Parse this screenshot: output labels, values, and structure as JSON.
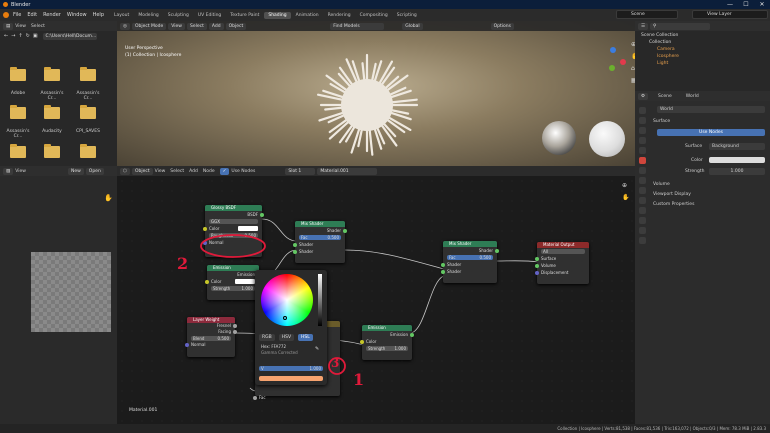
{
  "window": {
    "title": "Blender",
    "buttons": [
      "—",
      "☐",
      "✕"
    ]
  },
  "menu": [
    "File",
    "Edit",
    "Render",
    "Window",
    "Help"
  ],
  "workspaces": [
    "Layout",
    "Modeling",
    "Sculpting",
    "UV Editing",
    "Texture Paint",
    "Shading",
    "Animation",
    "Rendering",
    "Compositing",
    "Scripting"
  ],
  "active_workspace": "Shading",
  "scene": "Scene",
  "view_layer": "View Layer",
  "file_browser": {
    "menu": [
      "View",
      "Select"
    ],
    "path": "C:\\Users\\Hell\\Docum...",
    "folders": [
      "Adobe",
      "Assassin's Cr...",
      "Assassin's Cr...",
      "Assassin's Cr...",
      "Audacity",
      "CPI_SAVES",
      "",
      "",
      ""
    ]
  },
  "image_editor": {
    "menu": [
      "View"
    ],
    "new": "New",
    "open": "Open"
  },
  "viewport": {
    "mode": "Object Mode",
    "menu": [
      "View",
      "Select",
      "Add",
      "Object"
    ],
    "info1": "User Perspective",
    "info2": "(1) Collection | Icosphere",
    "search": "Find Models",
    "orientation": "Global",
    "options": "Options"
  },
  "node_editor": {
    "type": "Object",
    "menu": [
      "View",
      "Select",
      "Add",
      "Node"
    ],
    "use_nodes": "Use Nodes",
    "slot": "Slot 1",
    "material": "Material.001",
    "footer": "Material.001"
  },
  "nodes": {
    "glossy": {
      "title": "Glossy BSDF",
      "out": "BSDF",
      "dist": "GGX",
      "color": "Color",
      "roughness": "Roughness",
      "roughness_val": "0.500",
      "normal": "Normal"
    },
    "mix1": {
      "title": "Mix Shader",
      "out": "Shader",
      "fac": "Fac",
      "fac_val": "0.500",
      "in1": "Shader",
      "in2": "Shader"
    },
    "emission1": {
      "title": "Emission",
      "out": "Emission",
      "color": "Color",
      "strength": "Strength",
      "strength_val": "1.000"
    },
    "mix2": {
      "title": "Mix Shader",
      "out": "Shader",
      "fac": "Fac",
      "fac_val": "0.500",
      "in1": "Shader",
      "in2": "Shader"
    },
    "output": {
      "title": "Material Output",
      "target": "All",
      "surface": "Surface",
      "volume": "Volume",
      "displacement": "Displacement"
    },
    "layer": {
      "title": "Layer Weight",
      "fresnel": "Fresnel",
      "facing": "Facing",
      "blend": "Blend",
      "blend_val": "0.500",
      "normal": "Normal"
    },
    "emission2": {
      "title": "Emission",
      "out": "Emission",
      "color": "Color",
      "strength": "Strength",
      "strength_val": "1.000"
    },
    "mixrgb": {
      "fac": "Fac"
    }
  },
  "color_picker": {
    "tabs": [
      "RGB",
      "HSV",
      "HSL"
    ],
    "hex": "Hex: FFA772",
    "gamma": "Gamma Corrected",
    "value": "V",
    "value_val": "1.000",
    "swatch": "#f5a26e"
  },
  "annotations": {
    "a1": "1",
    "a2": "2",
    "a3": "3"
  },
  "outliner": {
    "title": "Scene Collection",
    "items": [
      "Collection",
      "Camera",
      "Icosphere",
      "Light"
    ]
  },
  "properties": {
    "scene": "Scene",
    "world_tab": "World",
    "world": "World",
    "surface": "Surface",
    "use_nodes": "Use Nodes",
    "surface_label": "Surface",
    "surface_val": "Background",
    "color": "Color",
    "strength": "Strength",
    "strength_val": "1.000",
    "sections": [
      "Volume",
      "Viewport Display",
      "Custom Properties"
    ]
  },
  "status": "Collection | Icosphere | Verts:81,538 | Faces:81,536 | Tris:163,072 | Objects:0/3 | Mem: 78.3 MiB | 2.83.3"
}
